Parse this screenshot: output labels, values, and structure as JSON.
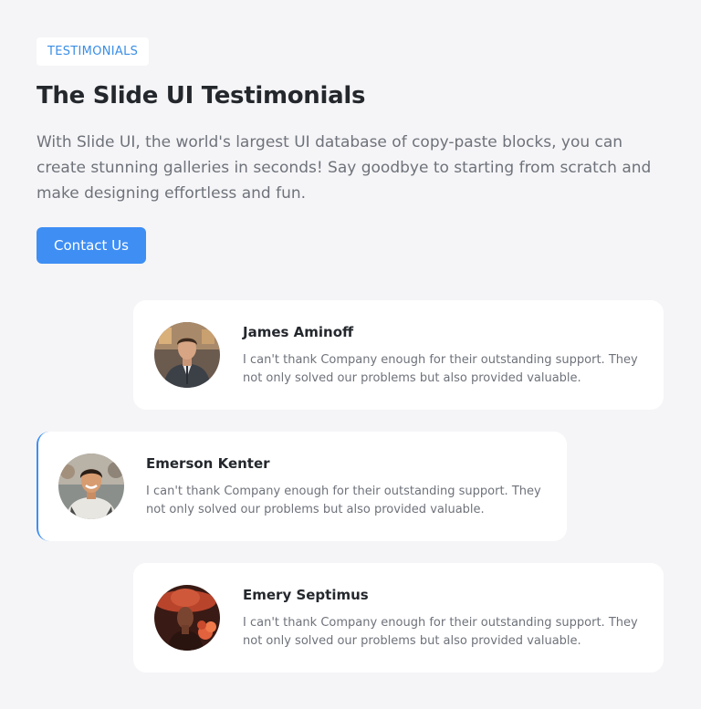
{
  "header": {
    "badge": "TESTIMONIALS",
    "title": "The Slide UI Testimonials",
    "description": "With Slide UI, the world's largest UI database of copy-paste blocks, you can create stunning galleries in seconds! Say goodbye to starting from scratch and make designing effortless and fun.",
    "cta_label": "Contact Us"
  },
  "colors": {
    "accent": "#3e8ef4",
    "background": "#f5f5f7",
    "card": "#ffffff"
  },
  "testimonials": [
    {
      "name": "James Aminoff",
      "quote": "I can't thank Company enough for their outstanding support. They not only solved our problems but also provided valuable.",
      "avatar_icon": "avatar-james-aminoff",
      "active": false
    },
    {
      "name": "Emerson Kenter",
      "quote": "I can't thank Company enough for their outstanding support. They not only solved our problems but also provided valuable.",
      "avatar_icon": "avatar-emerson-kenter",
      "active": true
    },
    {
      "name": "Emery Septimus",
      "quote": "I can't thank Company enough for their outstanding support. They not only solved our problems but also provided valuable.",
      "avatar_icon": "avatar-emery-septimus",
      "active": false
    }
  ]
}
